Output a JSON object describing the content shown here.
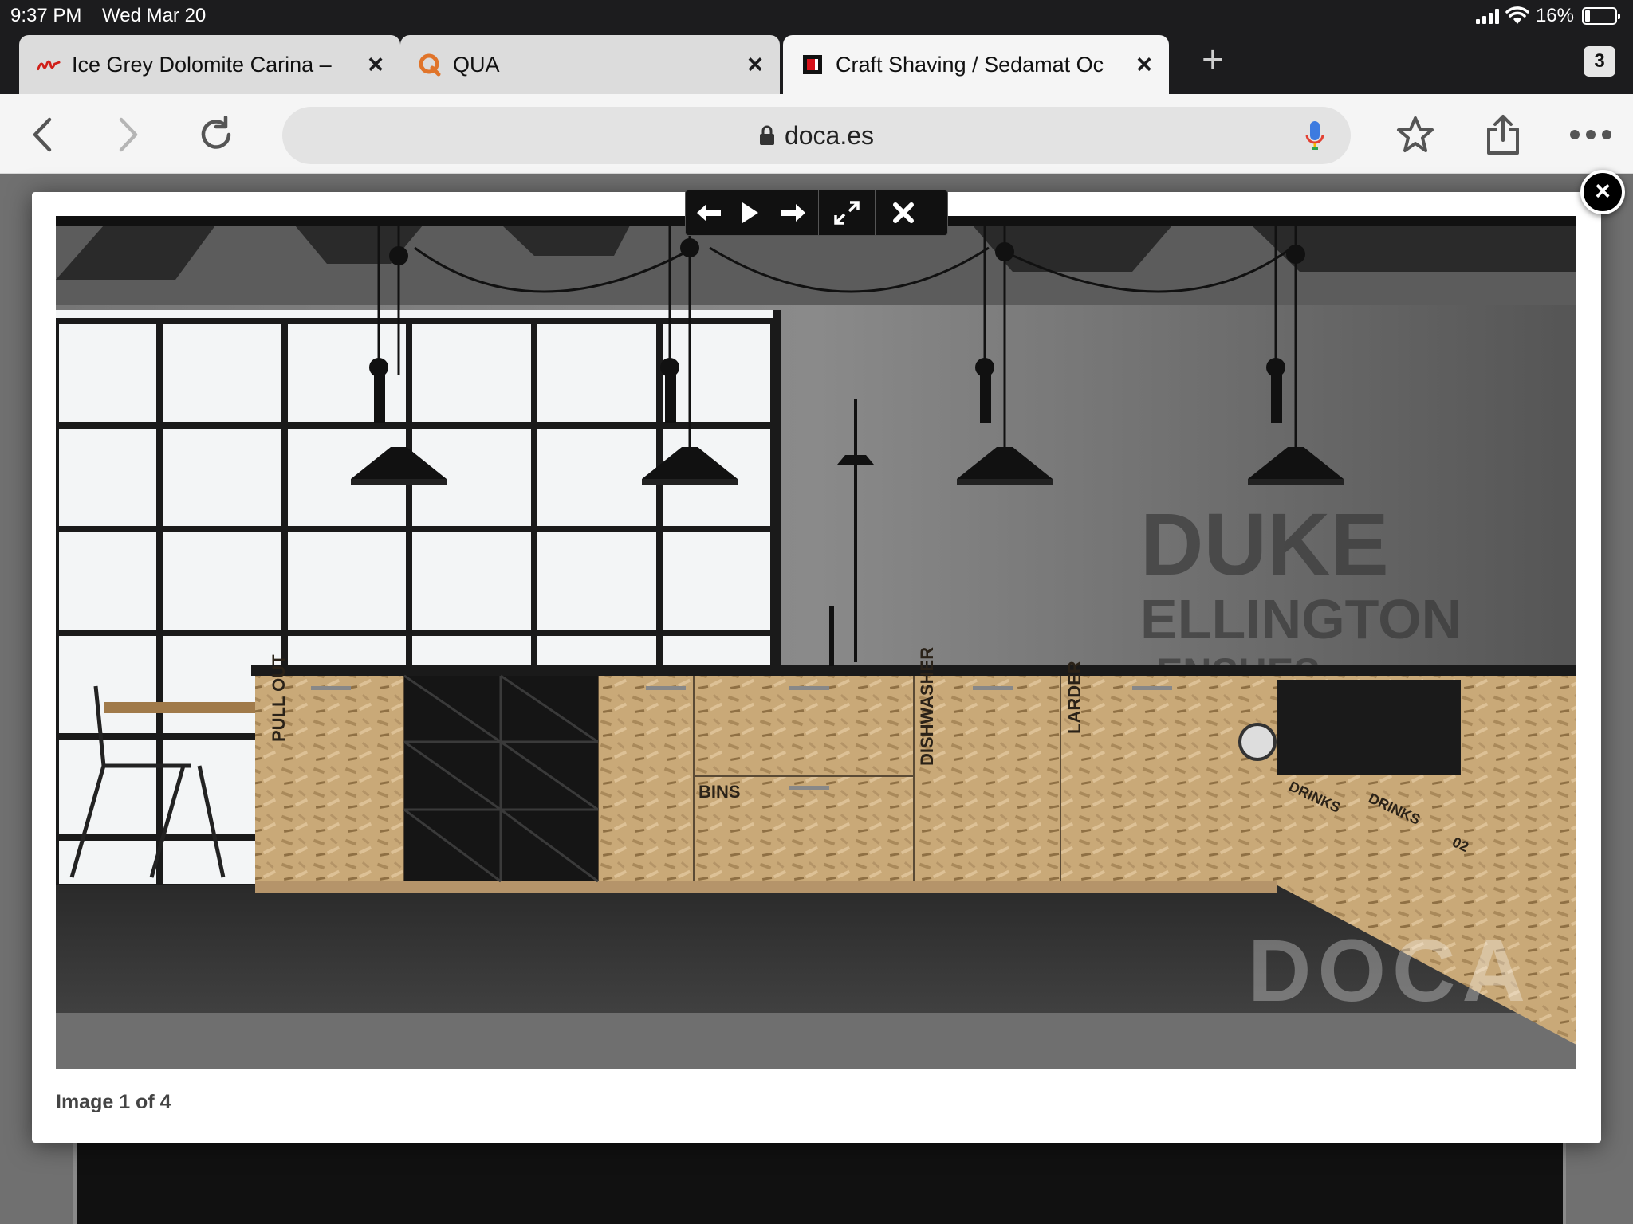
{
  "status_bar": {
    "time": "9:37 PM",
    "date": "Wed Mar 20",
    "battery": "16%",
    "battery_level": 0.16
  },
  "tabs": [
    {
      "title": "Ice Grey Dolomite Carina –",
      "favicon": "red-squiggle-logo-icon",
      "active": false
    },
    {
      "title": "QUA",
      "favicon": "orange-q-logo-icon",
      "active": false
    },
    {
      "title": "Craft Shaving / Sedamat Oc",
      "favicon": "red-black-square-logo-icon",
      "active": true
    }
  ],
  "tab_count": "3",
  "toolbar": {
    "url": "doca.es",
    "icons": [
      "back-arrow-icon",
      "forward-arrow-icon",
      "reload-icon",
      "lock-icon",
      "microphone-icon",
      "bookmark-star-icon",
      "share-icon",
      "more-dots-icon"
    ]
  },
  "lightbox": {
    "caption": "Image 1 of 4",
    "controls": [
      "previous-arrow-icon",
      "play-icon",
      "next-arrow-icon",
      "fullscreen-icon",
      "close-icon"
    ]
  },
  "photo_labels": {
    "pull_out": "PULL OUT",
    "bins": "BINS",
    "dishwasher": "DISHWASHER",
    "larder": "LARDER",
    "drinks": "DRINKS",
    "drinks_02": "DRINKS",
    "number": "02",
    "watermark": "DOCA"
  },
  "colors": {
    "chrome_dark": "#1c1c1e",
    "toolbar_bg": "#f5f5f5",
    "osb_wood": "#c9a978",
    "countertop": "#1a1a1a"
  }
}
